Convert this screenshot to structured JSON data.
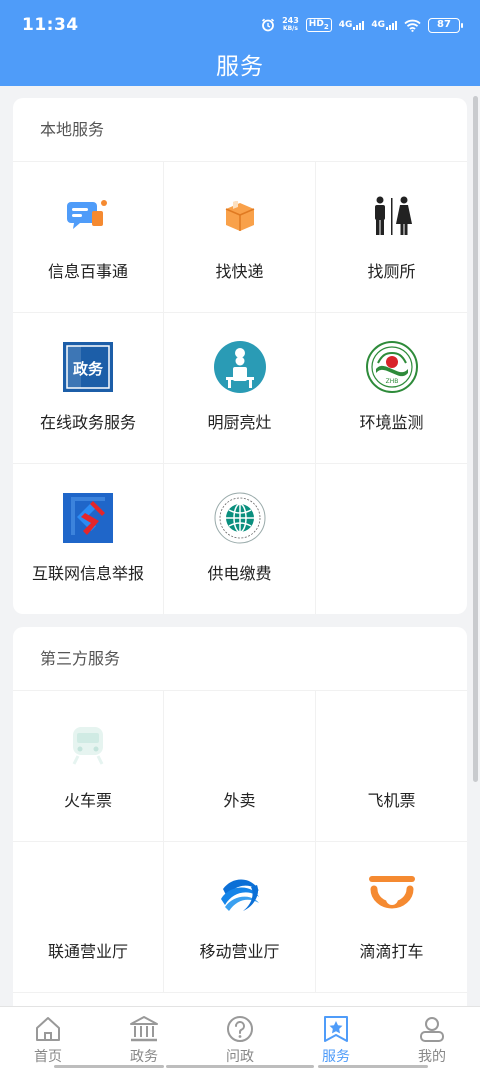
{
  "status": {
    "time": "11:34",
    "speed_value": "243",
    "speed_unit": "KB/s",
    "hd": "HD",
    "hd_sub": "2",
    "net1": "4G",
    "net2": "4G",
    "battery": "87"
  },
  "header": {
    "title": "服务"
  },
  "local": {
    "title": "本地服务",
    "items": [
      {
        "label": "信息百事通",
        "icon": "chat-bubble-icon"
      },
      {
        "label": "找快递",
        "icon": "package-icon"
      },
      {
        "label": "找厕所",
        "icon": "restroom-icon"
      },
      {
        "label": "在线政务服务",
        "icon": "government-icon"
      },
      {
        "label": "明厨亮灶",
        "icon": "chef-icon"
      },
      {
        "label": "环境监测",
        "icon": "environment-emblem-icon"
      },
      {
        "label": "互联网信息举报",
        "icon": "report-icon"
      },
      {
        "label": "供电缴费",
        "icon": "state-grid-icon"
      }
    ],
    "emblem_text": "ZHB"
  },
  "third": {
    "title": "第三方服务",
    "items": [
      {
        "label": "火车票",
        "icon": "train-icon"
      },
      {
        "label": "外卖",
        "icon": "food-delivery-icon"
      },
      {
        "label": "飞机票",
        "icon": "plane-icon"
      },
      {
        "label": "联通营业厅",
        "icon": "unicom-icon"
      },
      {
        "label": "移动营业厅",
        "icon": "china-mobile-icon"
      },
      {
        "label": "滴滴打车",
        "icon": "didi-icon"
      }
    ]
  },
  "gov_badge_text": "政务",
  "tabbar": {
    "items": [
      {
        "label": "首页",
        "icon": "home-icon"
      },
      {
        "label": "政务",
        "icon": "bank-icon"
      },
      {
        "label": "问政",
        "icon": "question-icon"
      },
      {
        "label": "服务",
        "icon": "star-bookmark-icon"
      },
      {
        "label": "我的",
        "icon": "user-icon"
      }
    ],
    "active_index": 3
  },
  "colors": {
    "primary": "#4f9cf9",
    "orange": "#f58a31",
    "tab_inactive": "#888888"
  }
}
